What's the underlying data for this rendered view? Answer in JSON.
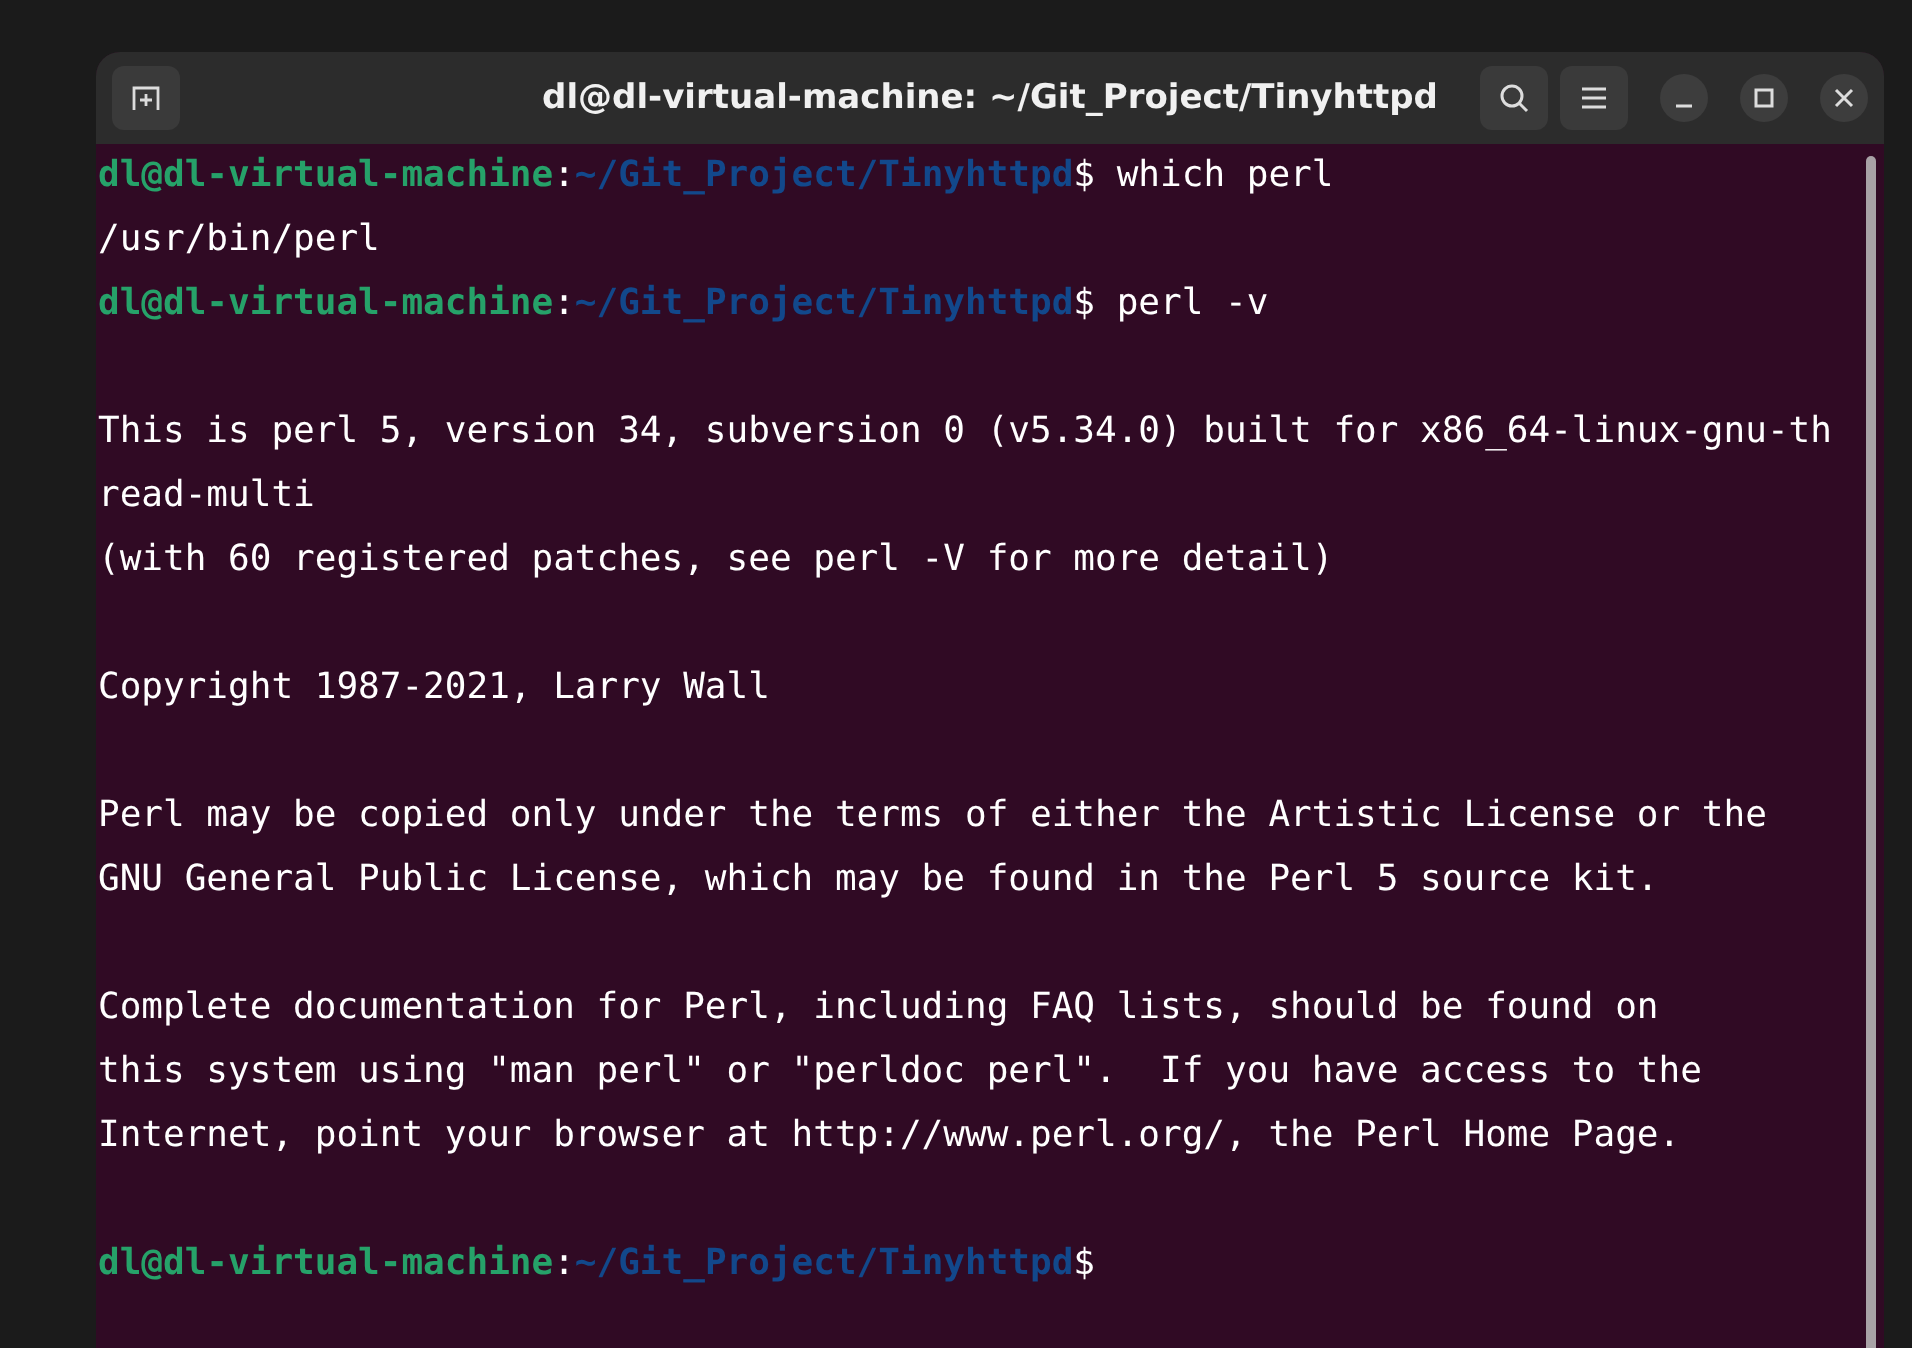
{
  "window": {
    "title": "dl@dl-virtual-machine: ~/Git_Project/Tinyhttpd"
  },
  "terminal": {
    "lines": [
      {
        "kind": "prompt",
        "user": "dl@dl-virtual-machine",
        "separator": ":",
        "path": "~/Git_Project/Tinyhttpd",
        "symbol": "$",
        "command": "which perl"
      },
      {
        "kind": "output",
        "text": "/usr/bin/perl"
      },
      {
        "kind": "prompt",
        "user": "dl@dl-virtual-machine",
        "separator": ":",
        "path": "~/Git_Project/Tinyhttpd",
        "symbol": "$",
        "command": "perl -v"
      },
      {
        "kind": "blank"
      },
      {
        "kind": "output",
        "text": "This is perl 5, version 34, subversion 0 (v5.34.0) built for x86_64-linux-gnu-th"
      },
      {
        "kind": "output",
        "text": "read-multi"
      },
      {
        "kind": "output",
        "text": "(with 60 registered patches, see perl -V for more detail)"
      },
      {
        "kind": "blank"
      },
      {
        "kind": "output",
        "text": "Copyright 1987-2021, Larry Wall"
      },
      {
        "kind": "blank"
      },
      {
        "kind": "output",
        "text": "Perl may be copied only under the terms of either the Artistic License or the"
      },
      {
        "kind": "output",
        "text": "GNU General Public License, which may be found in the Perl 5 source kit."
      },
      {
        "kind": "blank"
      },
      {
        "kind": "output",
        "text": "Complete documentation for Perl, including FAQ lists, should be found on"
      },
      {
        "kind": "output",
        "text": "this system using \"man perl\" or \"perldoc perl\".  If you have access to the"
      },
      {
        "kind": "output",
        "text": "Internet, point your browser at http://www.perl.org/, the Perl Home Page."
      },
      {
        "kind": "blank"
      },
      {
        "kind": "prompt",
        "user": "dl@dl-virtual-machine",
        "separator": ":",
        "path": "~/Git_Project/Tinyhttpd",
        "symbol": "$"
      }
    ]
  }
}
